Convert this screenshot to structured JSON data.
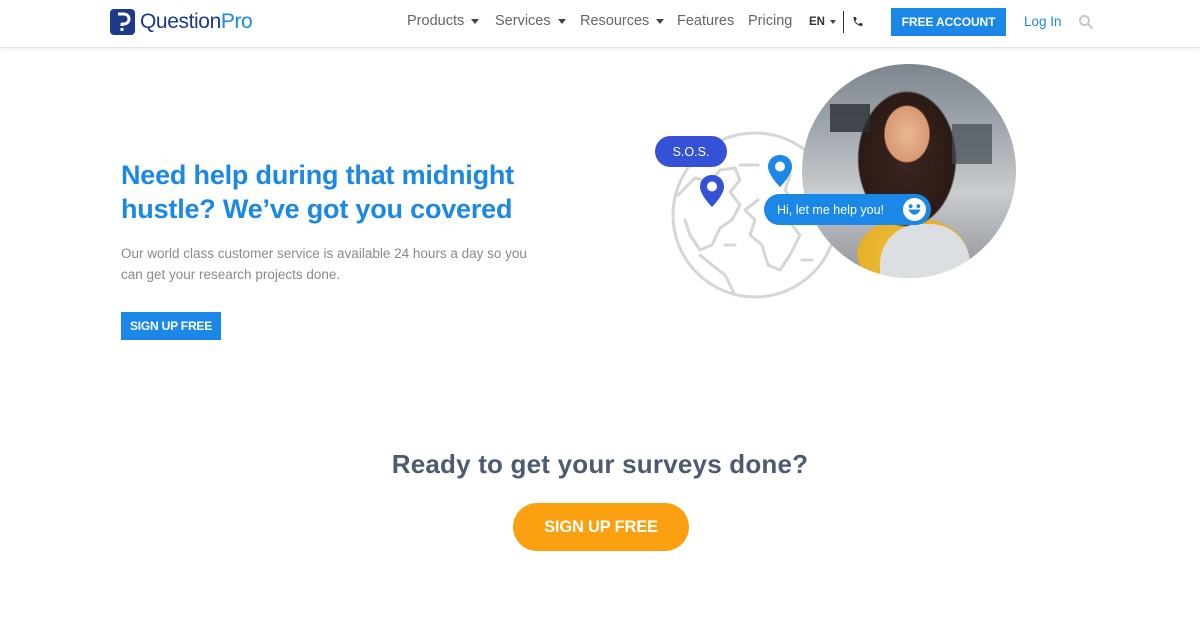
{
  "brand": {
    "name_part1": "Question",
    "name_part2": "Pro",
    "logo_glyph": "?",
    "colors": {
      "navy": "#1d3a8a",
      "blue": "#1b87e6",
      "orange": "#fba011",
      "indigo": "#3552d6"
    }
  },
  "nav": {
    "items": [
      {
        "label": "Products",
        "has_dropdown": true
      },
      {
        "label": "Services",
        "has_dropdown": true
      },
      {
        "label": "Resources",
        "has_dropdown": true
      },
      {
        "label": "Features",
        "has_dropdown": false
      },
      {
        "label": "Pricing",
        "has_dropdown": false
      }
    ],
    "language": "EN",
    "phone_icon": "phone-icon",
    "free_account_label": "FREE ACCOUNT",
    "login_label": "Log In",
    "search_icon": "search-icon"
  },
  "hero": {
    "title": "Need help during that midnight hustle? We’ve got you covered",
    "description": "Our world class customer service is available 24 hours a day so you can get your research projects done.",
    "button_label": "SIGN UP FREE",
    "illustration": {
      "sos_bubble": "S.O.S.",
      "chat_bubble": "Hi, let me help you!",
      "icons": [
        "globe-icon",
        "map-pin-icon",
        "smiley-icon"
      ]
    }
  },
  "cta": {
    "title": "Ready to get your surveys done?",
    "button_label": "SIGN UP FREE"
  }
}
